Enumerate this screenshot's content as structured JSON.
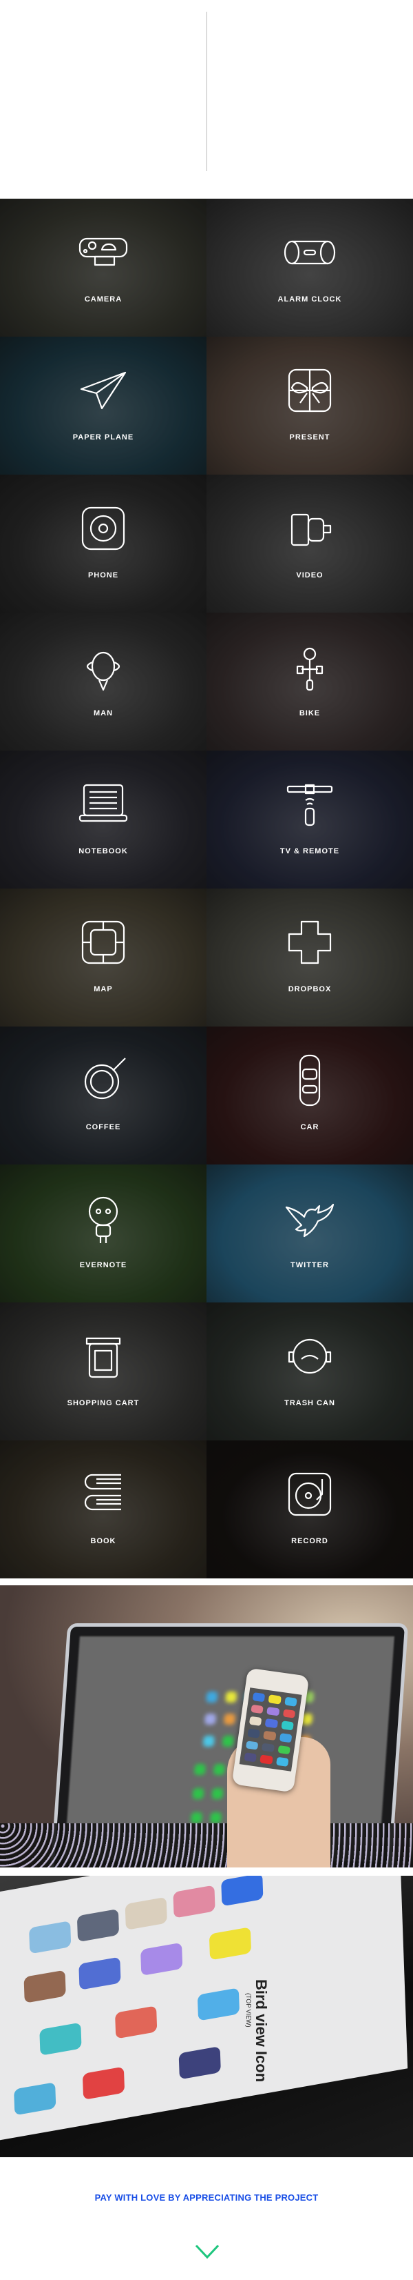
{
  "colors": {
    "footer_text": "#1a4fe6",
    "chevron": "#1ec67e",
    "divider": "#b8b8b8"
  },
  "tiles": [
    {
      "label": "CAMERA",
      "icon": "camera-icon",
      "bg": "#3c3d34"
    },
    {
      "label": "ALARM CLOCK",
      "icon": "alarm-clock-icon",
      "bg": "#424242"
    },
    {
      "label": "PAPER PLANE",
      "icon": "paper-plane-icon",
      "bg": "#1f3f4c"
    },
    {
      "label": "PRESENT",
      "icon": "present-icon",
      "bg": "#5a4a40"
    },
    {
      "label": "PHONE",
      "icon": "phone-icon",
      "bg": "#2e2e2e"
    },
    {
      "label": "VIDEO",
      "icon": "video-icon",
      "bg": "#3c3c3c"
    },
    {
      "label": "MAN",
      "icon": "man-icon",
      "bg": "#353535"
    },
    {
      "label": "BIKE",
      "icon": "bike-icon",
      "bg": "#3e3434"
    },
    {
      "label": "NOTEBOOK",
      "icon": "notebook-icon",
      "bg": "#2c2c34"
    },
    {
      "label": "TV & REMOTE",
      "icon": "tv-remote-icon",
      "bg": "#262a3e"
    },
    {
      "label": "MAP",
      "icon": "map-icon",
      "bg": "#4c4636"
    },
    {
      "label": "DROPBOX",
      "icon": "dropbox-icon",
      "bg": "#4a4a42"
    },
    {
      "label": "COFFEE",
      "icon": "coffee-icon",
      "bg": "#252b32"
    },
    {
      "label": "CAR",
      "icon": "car-icon",
      "bg": "#3a1c1c"
    },
    {
      "label": "EVERNOTE",
      "icon": "evernote-icon",
      "bg": "#2f4a24"
    },
    {
      "label": "TWITTER",
      "icon": "twitter-icon",
      "bg": "#2a6a8c"
    },
    {
      "label": "SHOPPING CART",
      "icon": "shopping-cart-icon",
      "bg": "#3a3a38"
    },
    {
      "label": "TRASH CAN",
      "icon": "trash-can-icon",
      "bg": "#2f3530"
    },
    {
      "label": "BOOK",
      "icon": "book-icon",
      "bg": "#3a3428"
    },
    {
      "label": "RECORD",
      "icon": "record-icon",
      "bg": "#181412"
    }
  ],
  "mockup": {
    "title": "Bird view Icon",
    "subtitle": "(TOP VIEW)"
  },
  "footer": {
    "text": "PAY WITH LOVE BY APPRECIATING THE PROJECT",
    "chevron_icon": "chevron-down-icon"
  }
}
